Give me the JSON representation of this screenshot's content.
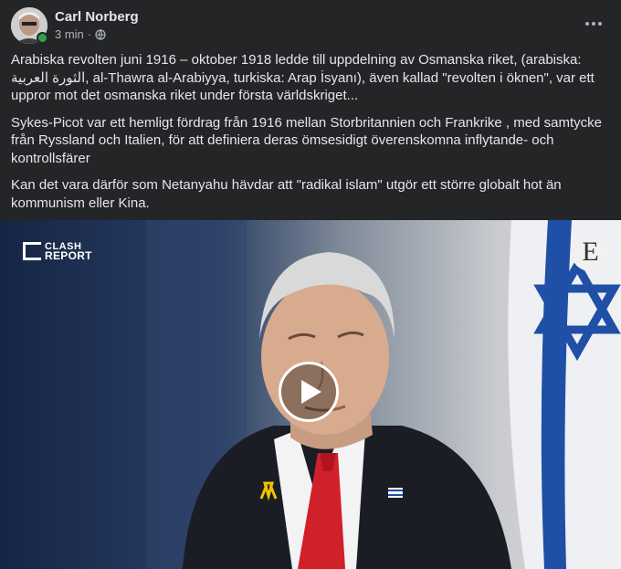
{
  "post": {
    "author": "Carl Norberg",
    "time": "3 min",
    "separator": "·",
    "privacy_icon": "globe-icon",
    "more_icon": "more-options-icon",
    "paragraphs": [
      "Arabiska revolten juni 1916 – oktober 1918 ledde till uppdelning av Osmanska riket, (arabiska: الثورة العربية, al-Thawra al-Arabiyya, turkiska: Arap İsyanı), även kallad \"revolten i öknen\", var ett uppror mot det osmanska riket under första världskriget...",
      "Sykes-Picot var ett hemligt fördrag från 1916 mellan Storbritannien och Frankrike , med samtycke från Ryssland och Italien, för att definiera deras ömsesidigt överenskomna inflytande- och kontrollsfärer",
      "Kan det vara därför som Netanyahu hävdar att \"radikal islam\" utgör ett större globalt hot än kommunism eller Kina."
    ]
  },
  "video": {
    "brand_top": "CLASH",
    "brand_bottom": "REPORT",
    "publisher_logo": "E",
    "play_icon": "play-icon"
  },
  "colors": {
    "background": "#242526",
    "text": "#e4e6eb",
    "secondary_text": "#b0b3b8",
    "online": "#31a24c",
    "tie": "#d0202a",
    "flag_blue": "#1f4fa6"
  }
}
